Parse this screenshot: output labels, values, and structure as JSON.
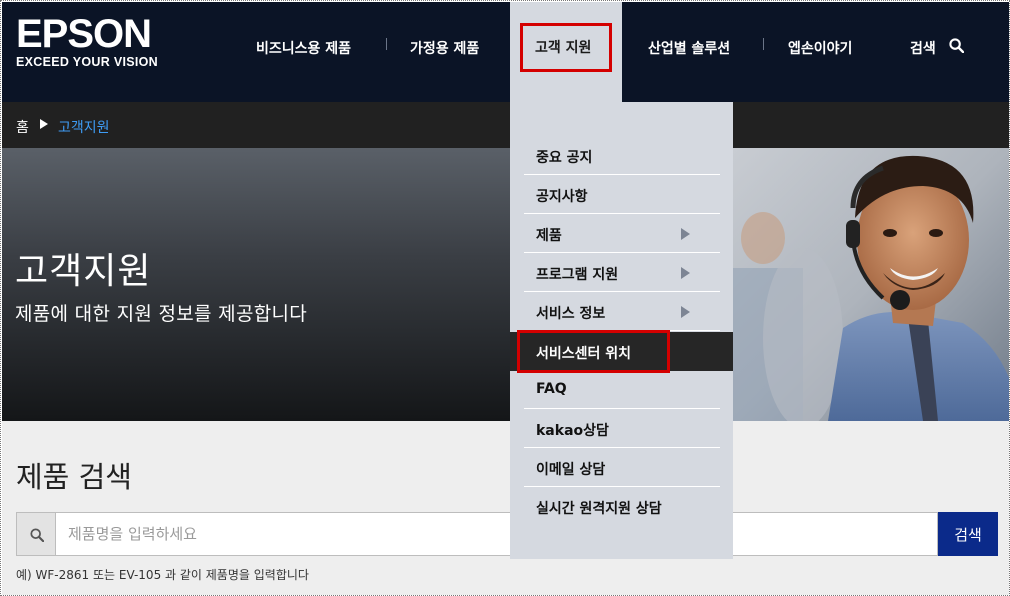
{
  "brand": {
    "name": "EPSON",
    "tagline": "EXCEED YOUR VISION"
  },
  "nav": {
    "items": [
      {
        "label": "비즈니스용 제품"
      },
      {
        "label": "가정용 제품"
      },
      {
        "label": "고객 지원",
        "active": true
      },
      {
        "label": "산업별 솔루션"
      },
      {
        "label": "엡손이야기"
      }
    ],
    "search_label": "검색",
    "search_icon": "search-icon"
  },
  "breadcrumb": {
    "home": "홈",
    "current": "고객지원"
  },
  "hero": {
    "title": "고객지원",
    "subtitle": "제품에 대한 지원 정보를 제공합니다"
  },
  "dropdown": {
    "items": [
      {
        "label": "중요 공지",
        "has_submenu": false
      },
      {
        "label": "공지사항",
        "has_submenu": false
      },
      {
        "label": "제품",
        "has_submenu": true
      },
      {
        "label": "프로그램 지원",
        "has_submenu": true
      },
      {
        "label": "서비스 정보",
        "has_submenu": true
      },
      {
        "label": "서비스센터 위치",
        "has_submenu": false,
        "highlighted": true
      },
      {
        "label": "FAQ",
        "has_submenu": false
      },
      {
        "label": "kakao상담",
        "has_submenu": false
      },
      {
        "label": "이메일 상담",
        "has_submenu": false
      },
      {
        "label": "실시간 원격지원 상담",
        "has_submenu": false
      }
    ]
  },
  "product_search": {
    "title": "제품 검색",
    "placeholder": "제품명을 입력하세요",
    "value": "",
    "button_label": "검색",
    "hint": "예) WF-2861 또는 EV-105 과 같이 제품명을 입력합니다"
  },
  "colors": {
    "header_bg": "#0b1426",
    "breadcrumb_bg": "#212121",
    "breadcrumb_link": "#3e9cf5",
    "dropdown_bg": "#d5d9e0",
    "highlight_bg": "#262626",
    "annotation_red": "#d40000",
    "search_button": "#0b2a8a"
  }
}
